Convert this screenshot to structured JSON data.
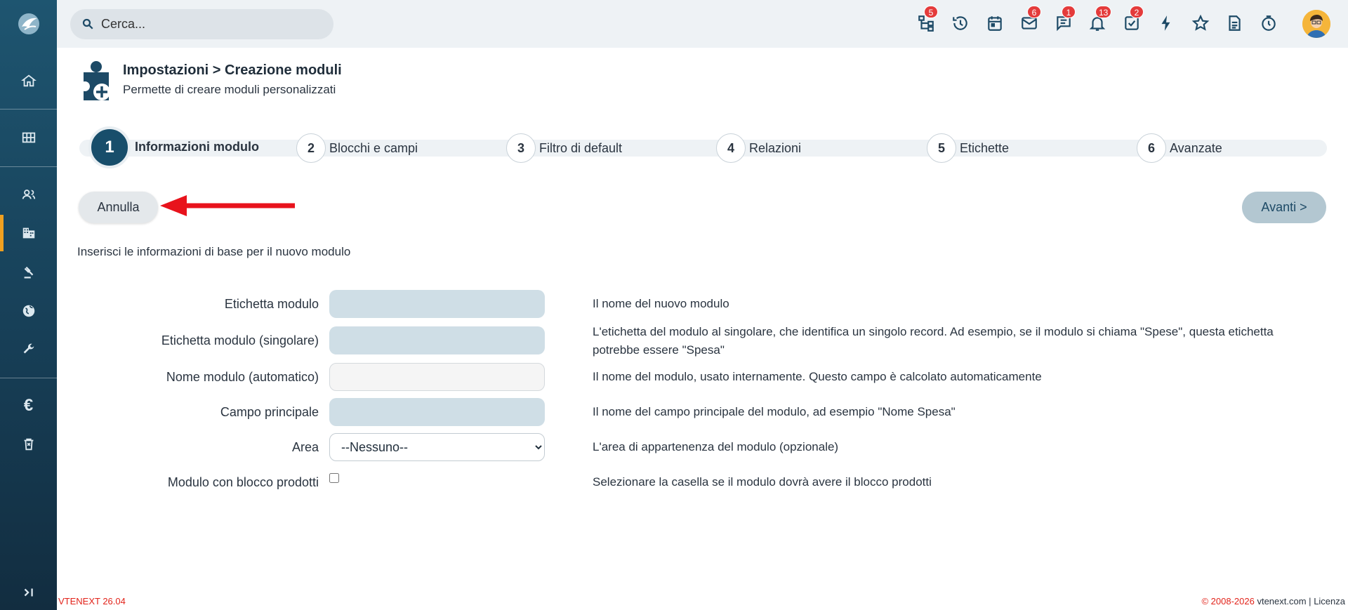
{
  "search": {
    "placeholder": "Cerca..."
  },
  "topbar": {
    "icons": [
      {
        "name": "hierarchy-icon",
        "badge": "5"
      },
      {
        "name": "history-icon",
        "badge": ""
      },
      {
        "name": "calendar-icon",
        "badge": ""
      },
      {
        "name": "mail-icon",
        "badge": "6"
      },
      {
        "name": "chat-icon",
        "badge": "1"
      },
      {
        "name": "bell-icon",
        "badge": "13"
      },
      {
        "name": "tasks-icon",
        "badge": "2"
      },
      {
        "name": "lightning-icon",
        "badge": ""
      },
      {
        "name": "star-icon",
        "badge": ""
      },
      {
        "name": "document-icon",
        "badge": ""
      },
      {
        "name": "timer-icon",
        "badge": ""
      }
    ]
  },
  "sidebar": {
    "items": [
      "home-icon",
      "grid-icon",
      "contacts-icon",
      "company-icon",
      "legal-icon",
      "globe-icon",
      "wrench-icon",
      "euro-icon",
      "trash-icon",
      "expand-icon"
    ]
  },
  "header": {
    "title": "Impostazioni > Creazione moduli",
    "subtitle": "Permette di creare moduli personalizzati"
  },
  "steps": [
    {
      "num": "1",
      "label": "Informazioni modulo",
      "active": true
    },
    {
      "num": "2",
      "label": "Blocchi e campi",
      "active": false
    },
    {
      "num": "3",
      "label": "Filtro di default",
      "active": false
    },
    {
      "num": "4",
      "label": "Relazioni",
      "active": false
    },
    {
      "num": "5",
      "label": "Etichette",
      "active": false
    },
    {
      "num": "6",
      "label": "Avanzate",
      "active": false
    }
  ],
  "buttons": {
    "cancel": "Annulla",
    "next": "Avanti >"
  },
  "intro": "Inserisci le informazioni di base per il nuovo modulo",
  "form": {
    "rows": [
      {
        "label": "Etichetta modulo",
        "value": "",
        "desc": "Il nome del nuovo modulo"
      },
      {
        "label": "Etichetta modulo (singolare)",
        "value": "",
        "desc": "L'etichetta del modulo al singolare, che identifica un singolo record. Ad esempio, se il modulo si chiama \"Spese\", questa etichetta potrebbe essere \"Spesa\""
      },
      {
        "label": "Nome modulo (automatico)",
        "value": "",
        "desc": "Il nome del modulo, usato internamente. Questo campo è calcolato automaticamente"
      },
      {
        "label": "Campo principale",
        "value": "",
        "desc": "Il nome del campo principale del modulo, ad esempio \"Nome Spesa\""
      },
      {
        "label": "Area",
        "value": "--Nessuno--",
        "desc": "L'area di appartenenza del modulo (opzionale)"
      },
      {
        "label": "Modulo con blocco prodotti",
        "value": false,
        "desc": "Selezionare la casella se il modulo dovrà avere il blocco prodotti"
      }
    ]
  },
  "footer": {
    "version": "VTENEXT 26.04",
    "copyright": "© 2008-2026",
    "site": "vtenext.com",
    "sep": "|",
    "license": "Licenza"
  },
  "colors": {
    "sidebar": "#173f57",
    "accent": "#f0a020",
    "badge": "#e43b3b",
    "step_active": "#184e6b",
    "arrow": "#e8131c"
  }
}
